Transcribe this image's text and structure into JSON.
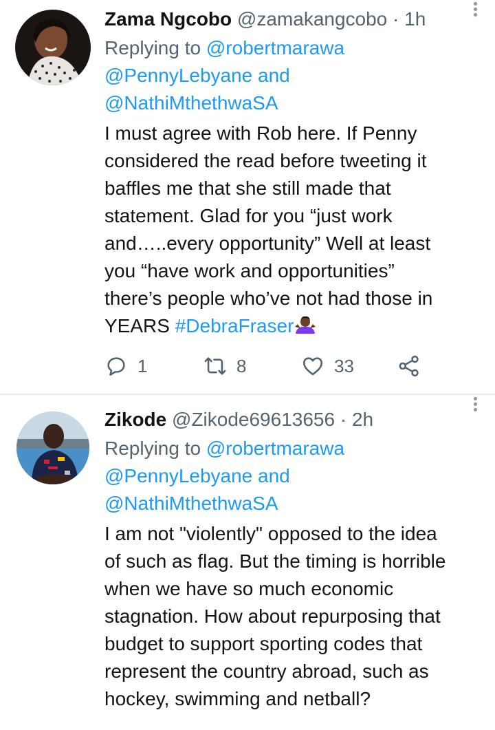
{
  "tweets": [
    {
      "display_name": "Zama Ngcobo",
      "handle": "@zamakangcobo",
      "separator": "·",
      "time": "1h",
      "replying_prefix": "Replying to",
      "replying_users": [
        "@robertmarawa",
        "@PennyLebyane",
        "@NathiMthethwaSA"
      ],
      "replying_and": "and",
      "body_lines": [
        "I must agree with Rob here. If Penny",
        "considered the read before tweeting it",
        "baffles me that she still made that",
        "statement. Glad for you “just work",
        "and…..every opportunity” Well at least",
        "you “have work and opportunities”",
        "there’s people who’ve not had those in"
      ],
      "body_last_prefix": "YEARS ",
      "hashtag": "#DebraFraser",
      "emoji": "person-shrugging-emoji",
      "reply_count": "1",
      "retweet_count": "8",
      "like_count": "33"
    },
    {
      "display_name": "Zikode",
      "handle": "@Zikode69613656",
      "separator": "·",
      "time": "2h",
      "replying_prefix": "Replying to",
      "replying_users": [
        "@robertmarawa",
        "@PennyLebyane",
        "@NathiMthethwaSA"
      ],
      "replying_and": "and",
      "body_lines": [
        "I am not \"violently\" opposed to the idea",
        "of such as flag. But the timing is horrible",
        "when we have so much economic",
        "stagnation. How about repurposing that",
        "budget to support sporting codes that",
        "represent the country abroad, such as",
        "hockey, swimming and netball?"
      ]
    }
  ],
  "icons": {
    "reply": "reply-icon",
    "retweet": "retweet-icon",
    "like": "heart-icon",
    "share": "share-icon",
    "more": "more-vertical-icon"
  },
  "colors": {
    "link": "#1d9bf0",
    "text": "#0f1419",
    "muted": "#536471",
    "divider": "#e6ecf0"
  }
}
